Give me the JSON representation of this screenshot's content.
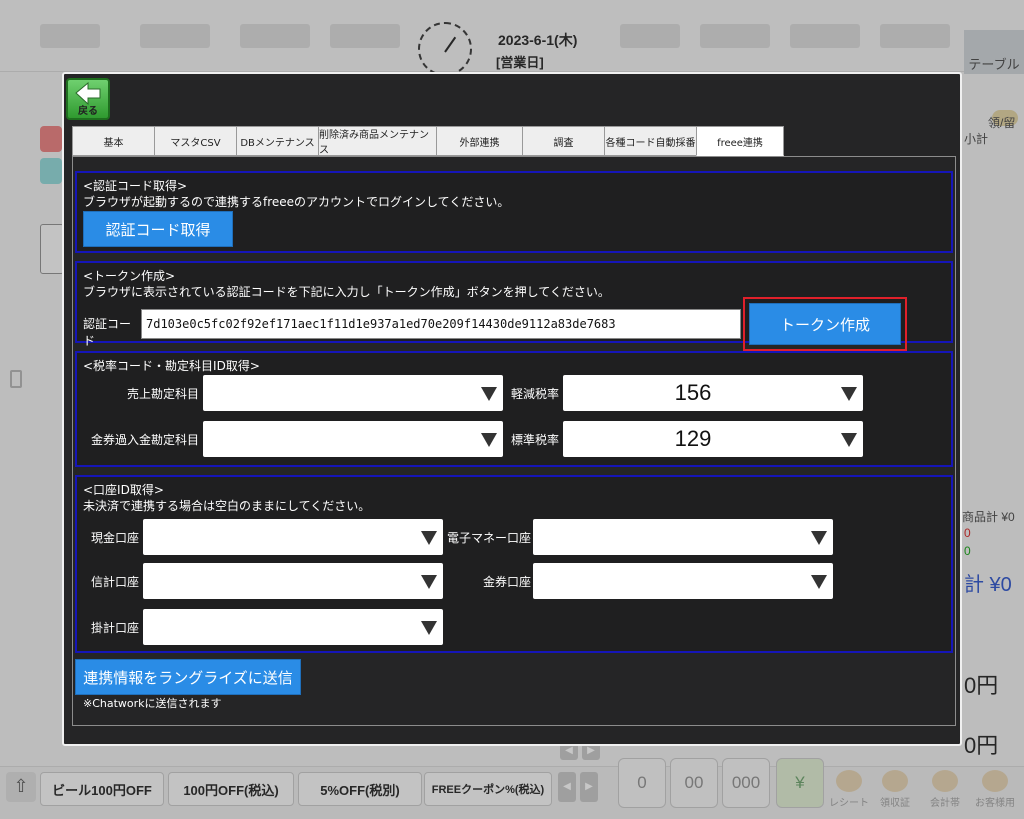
{
  "background": {
    "date": "2023-6-1(木)",
    "status": "[営業日]",
    "table_tab": "テーブル",
    "right_labels": [
      "領/留",
      "小計",
      "商品計 ¥0",
      "0",
      "0"
    ],
    "right_total": "計 ¥0",
    "right_yen1": "0円",
    "right_yen2": "0円",
    "coupons": [
      "ビール100円OFF",
      "100円OFF(税込)",
      "5%OFF(税別)",
      "FREEクーポン%(税込)"
    ],
    "keypad": [
      "0",
      "00",
      "000"
    ],
    "tools": [
      "レシート",
      "領収証",
      "会計帯",
      "お客様用"
    ]
  },
  "modal": {
    "back_label": "戻る",
    "tabs": [
      {
        "label": "基本",
        "active": false
      },
      {
        "label": "マスタCSV",
        "active": false
      },
      {
        "label": "DBメンテナンス",
        "active": false
      },
      {
        "label": "削除済み商品メンテナンス",
        "active": false
      },
      {
        "label": "外部連携",
        "active": false
      },
      {
        "label": "調査",
        "active": false
      },
      {
        "label": "各種コード自動採番",
        "active": false
      },
      {
        "label": "freee連携",
        "active": true
      }
    ],
    "auth": {
      "title": "<認証コード取得>",
      "desc": "ブラウザが起動するので連携するfreeeのアカウントでログインしてください。",
      "button": "認証コード取得"
    },
    "token": {
      "title": "<トークン作成>",
      "desc": "ブラウザに表示されている認証コードを下記に入力し「トークン作成」ボタンを押してください。",
      "code_label": "認証コード",
      "code_value": "7d103e0c5fc02f92ef171aec1f11d1e937a1ed70e209f14430de9112a83de7683",
      "button": "トークン作成"
    },
    "tax": {
      "title": "<税率コード・勘定科目ID取得>",
      "sales_account_label": "売上勘定科目",
      "sales_account_value": "",
      "reduced_rate_label": "軽減税率",
      "reduced_rate_value": "156",
      "voucher_overpay_label": "金券過入金勘定科目",
      "voucher_overpay_value": "",
      "standard_rate_label": "標準税率",
      "standard_rate_value": "129"
    },
    "account": {
      "title": "<口座ID取得>",
      "desc": "未決済で連携する場合は空白のままにしてください。",
      "cash_label": "現金口座",
      "emoney_label": "電子マネー口座",
      "credit_label": "信計口座",
      "voucher_label": "金券口座",
      "tab_label": "掛計口座"
    },
    "send_button": "連携情報をラングライズに送信",
    "note": "※Chatworkに送信されます"
  },
  "colors": {
    "accent_blue": "#2a8ce6",
    "section_border": "#1515b8",
    "highlight_red": "#e0202a"
  }
}
